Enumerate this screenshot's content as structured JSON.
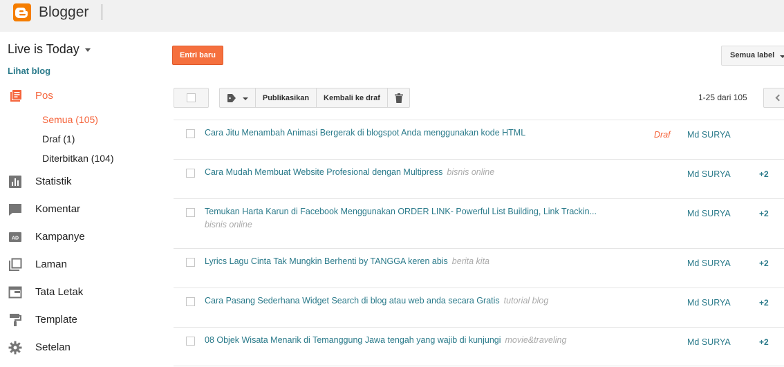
{
  "brand": {
    "name": "Blogger",
    "logo_color": "#f57d00"
  },
  "blog": {
    "title": "Live is Today",
    "view_link": "Lihat blog"
  },
  "sidebar": {
    "items": [
      {
        "label": "Pos",
        "icon": "posts-icon",
        "active": true
      },
      {
        "label": "Statistik",
        "icon": "stats-icon"
      },
      {
        "label": "Komentar",
        "icon": "comment-icon"
      },
      {
        "label": "Kampanye",
        "icon": "ad-icon"
      },
      {
        "label": "Laman",
        "icon": "pages-icon"
      },
      {
        "label": "Tata Letak",
        "icon": "layout-icon"
      },
      {
        "label": "Template",
        "icon": "paint-roller-icon"
      },
      {
        "label": "Setelan",
        "icon": "gear-icon"
      }
    ],
    "sub_items": [
      {
        "label": "Semua (105)",
        "active": true
      },
      {
        "label": "Draf (1)"
      },
      {
        "label": "Diterbitkan (104)"
      }
    ]
  },
  "toolbar": {
    "new_post": "Entri baru",
    "label_filter": "Semua label",
    "publish": "Publikasikan",
    "revert_draft": "Kembali ke draf",
    "pagination": "1-25 dari 105"
  },
  "posts": [
    {
      "title": "Cara Jitu Menambah Animasi Bergerak di blogspot Anda menggunakan kode HTML",
      "label": "",
      "status": "Draf",
      "author": "Md SURYA",
      "extra": ""
    },
    {
      "title": "Cara Mudah Membuat Website Profesional dengan Multipress",
      "label": "bisnis online",
      "status": "",
      "author": "Md SURYA",
      "extra": "+2"
    },
    {
      "title": "Temukan Harta Karun di Facebook Menggunakan ORDER LINK- Powerful List Building, Link Trackin...",
      "label": "bisnis online",
      "status": "",
      "author": "Md SURYA",
      "extra": "+2"
    },
    {
      "title": "Lyrics Lagu Cinta Tak Mungkin Berhenti by TANGGA keren abis",
      "label": "berita kita",
      "status": "",
      "author": "Md SURYA",
      "extra": "+2"
    },
    {
      "title": "Cara Pasang Sederhana Widget Search di blog atau web anda secara Gratis",
      "label": "tutorial blog",
      "status": "",
      "author": "Md SURYA",
      "extra": "+2"
    },
    {
      "title": "08 Objek Wisata Menarik di Temanggung Jawa tengah yang wajib di kunjungi",
      "label": "movie&traveling",
      "status": "",
      "author": "Md SURYA",
      "extra": "+2"
    }
  ],
  "colors": {
    "accent": "#f5643b",
    "link": "#2a7a8a",
    "button": "#f5703e"
  }
}
